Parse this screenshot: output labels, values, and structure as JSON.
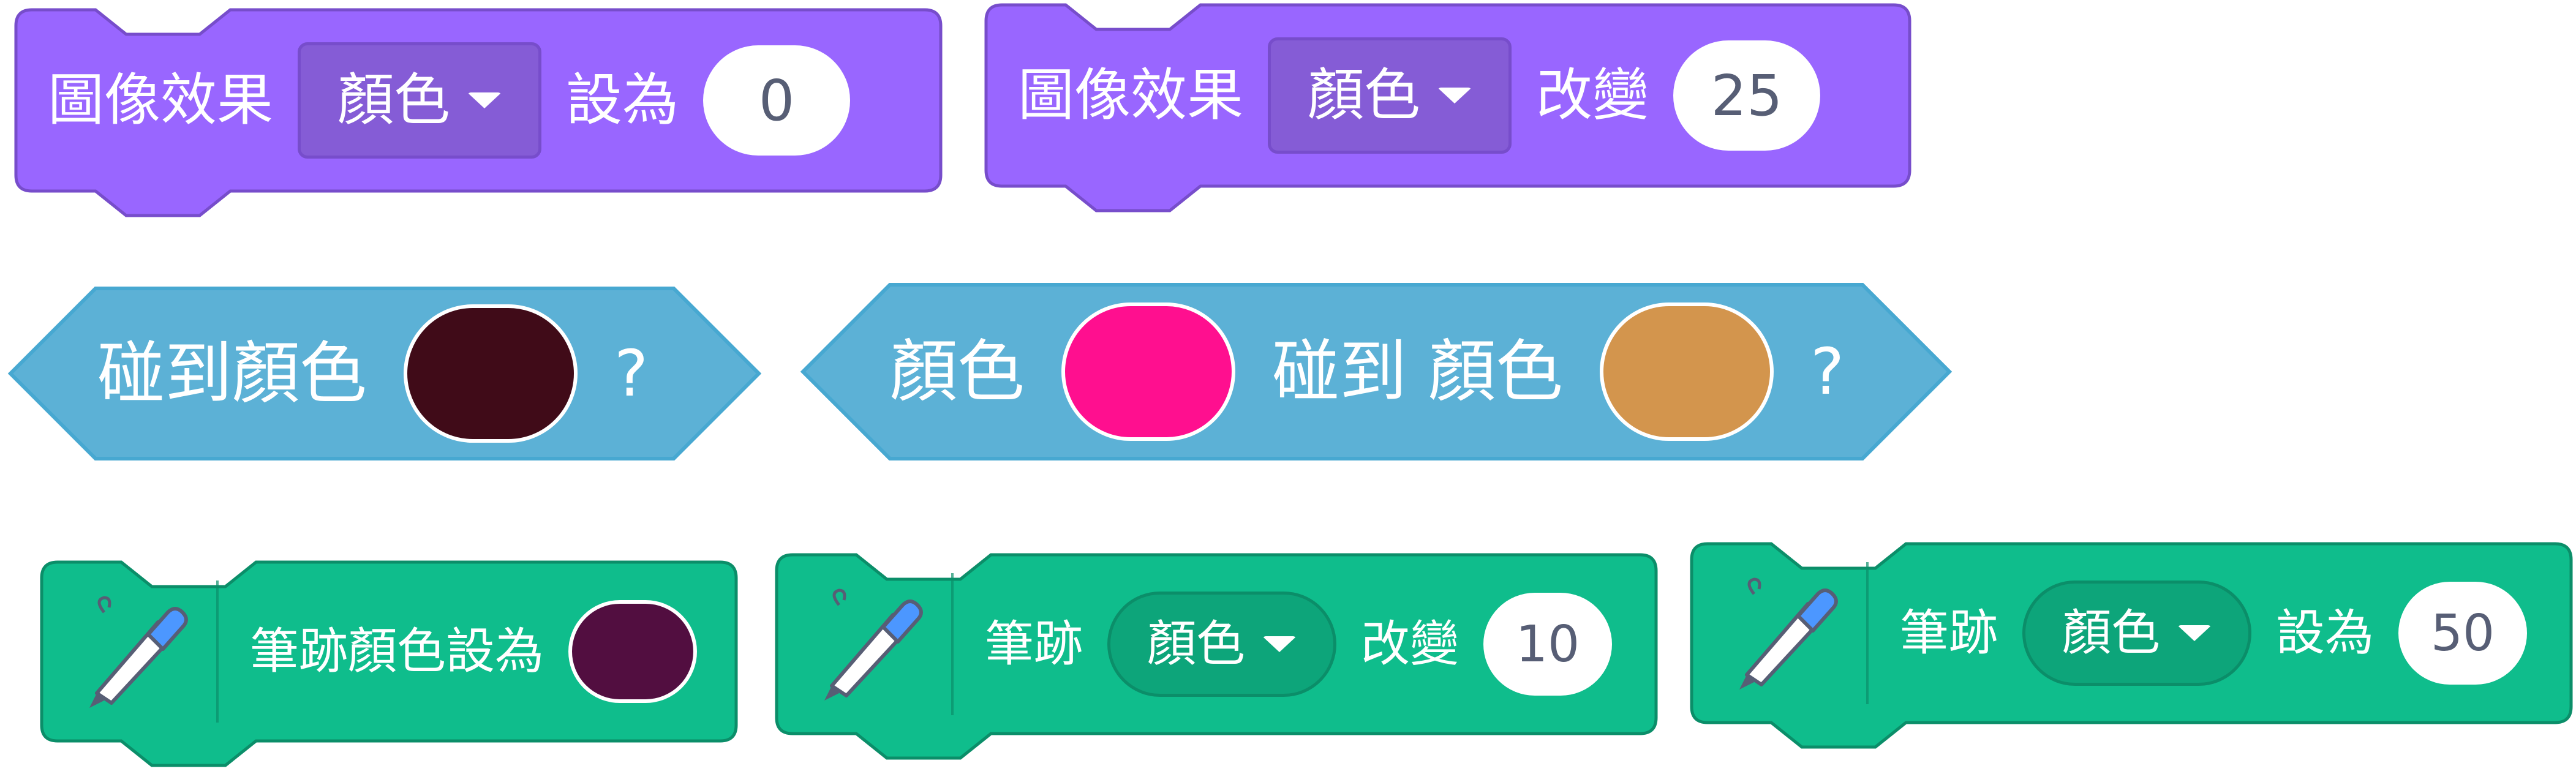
{
  "looks_set_block": {
    "label": "圖像效果",
    "effect_menu": "顏色",
    "verb": "設為",
    "value": "0"
  },
  "looks_change_block": {
    "label": "圖像效果",
    "effect_menu": "顏色",
    "verb": "改變",
    "value": "25"
  },
  "sensing_touching_color": {
    "label": "碰到顏色",
    "color": "#400B18",
    "suffix": "?"
  },
  "sensing_color_touching_color": {
    "label1": "顏色",
    "color1": "#FF0F8F",
    "label2": "碰到 顏色",
    "color2": "#D3954D",
    "suffix": "?"
  },
  "pen_set_color_block": {
    "label": "筆跡顏色設為",
    "color": "#520E40",
    "icon": "pen-icon"
  },
  "pen_change_param_block": {
    "label": "筆跡",
    "param_menu": "顏色",
    "verb": "改變",
    "value": "10",
    "icon": "pen-icon"
  },
  "pen_set_param_block": {
    "label": "筆跡",
    "param_menu": "顏色",
    "verb": "設為",
    "value": "50",
    "icon": "pen-icon"
  },
  "colors": {
    "looks": "#9966FF",
    "sensing": "#5CB1D6",
    "pen": "#0FBD8C"
  }
}
